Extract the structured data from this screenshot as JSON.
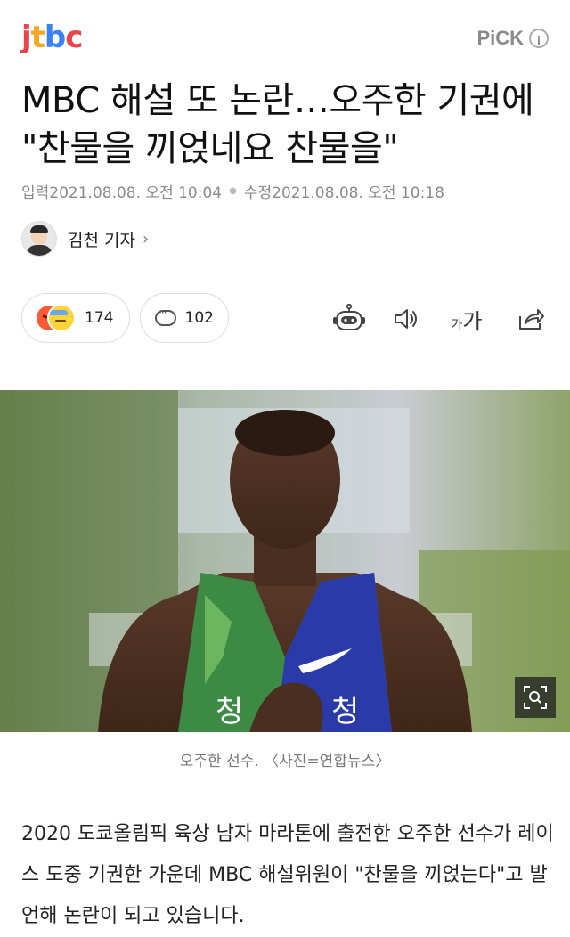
{
  "header": {
    "logo_parts": [
      "j",
      "t",
      "b",
      "c"
    ],
    "pick_label": "PiCK",
    "info_icon": "i"
  },
  "article": {
    "title": "MBC 해설 또 논란…오주한 기권에 \"찬물을 끼얹네요 찬물을\"",
    "input_label": "입력",
    "input_date": "2021.08.08. 오전 10:04",
    "update_label": "수정",
    "update_date": "2021.08.08. 오전 10:18",
    "author": "김천 기자",
    "author_chevron": "›",
    "reaction_count": "174",
    "comment_count": "102",
    "font_size_label_small": "가",
    "font_size_label_large": "가",
    "photo_caption": "오주한 선수. 〈사진=연합뉴스〉",
    "body": "2020 도쿄올림픽 육상 남자 마라톤에 출전한 오주한 선수가 레이스 도중 기권한 가운데 MBC 해설위원이 \"찬물을 끼얹는다\"고 발언해 논란이 되고 있습니다."
  },
  "photo": {
    "jersey_text_left": "청",
    "jersey_text_right": "청"
  },
  "colors": {
    "logo_red": "#e9434b",
    "logo_orange": "#f5a623",
    "logo_blue": "#3b82f6"
  }
}
